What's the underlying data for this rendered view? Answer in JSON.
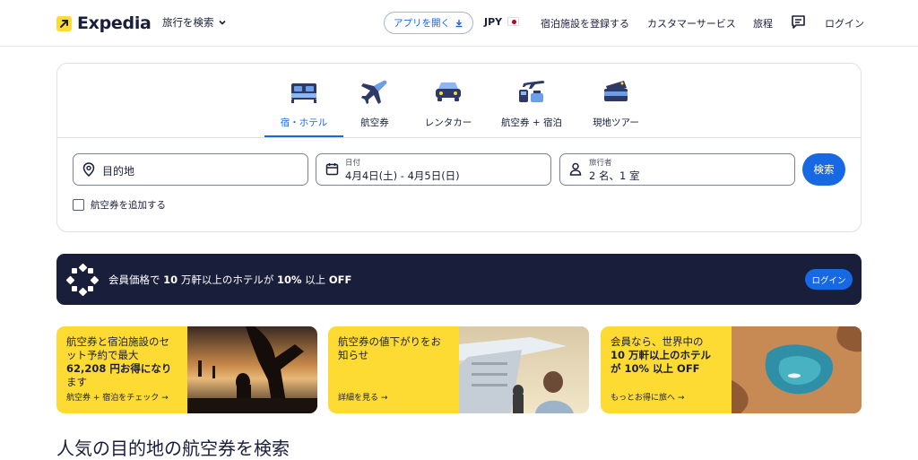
{
  "header": {
    "logo_text": "Expedia",
    "trip_search": "旅行を検索",
    "app_button": "アプリを開く",
    "currency": "JPY",
    "list_property": "宿泊施設を登録する",
    "customer_service": "カスタマーサービス",
    "trips": "旅程",
    "login": "ログイン"
  },
  "tabs": [
    {
      "label": "宿・ホテル",
      "icon": "bed-icon",
      "active": true
    },
    {
      "label": "航空券",
      "icon": "airplane-icon"
    },
    {
      "label": "レンタカー",
      "icon": "car-icon"
    },
    {
      "label": "航空券 + 宿泊",
      "icon": "flight-hotel-icon"
    },
    {
      "label": "現地ツアー",
      "icon": "ticket-icon"
    }
  ],
  "search": {
    "destination_placeholder": "目的地",
    "dates_label": "日付",
    "dates_value": "4月4日(土) - 4月5日(日)",
    "travelers_label": "旅行者",
    "travelers_value": "2 名、1 室",
    "search_button": "検索",
    "add_flight": "航空券を追加する"
  },
  "banner": {
    "text_parts": [
      "会員価格で ",
      "10",
      " 万軒以上のホテルが ",
      "10%",
      " 以上 ",
      "OFF"
    ],
    "login_button": "ログイン"
  },
  "promos": [
    {
      "lines": [
        "航空券と宿泊施設のセ",
        "ット予約で最大",
        "62,208 円お得になり",
        "ます"
      ],
      "link": "航空券 + 宿泊をチェック"
    },
    {
      "lines": [
        "航空券の値下がりをお",
        "知らせ"
      ],
      "link": "詳細を見る"
    },
    {
      "lines": [
        "会員なら、世界中の",
        "10 万軒以上のホテル",
        "が 10% 以上 OFF"
      ],
      "link": "もっとお得に旅へ"
    }
  ],
  "section_title": "人気の目的地の航空券を検索",
  "colors": {
    "brand_navy": "#191e3b",
    "accent_blue": "#1668e3",
    "promo_yellow": "#fddb32"
  }
}
